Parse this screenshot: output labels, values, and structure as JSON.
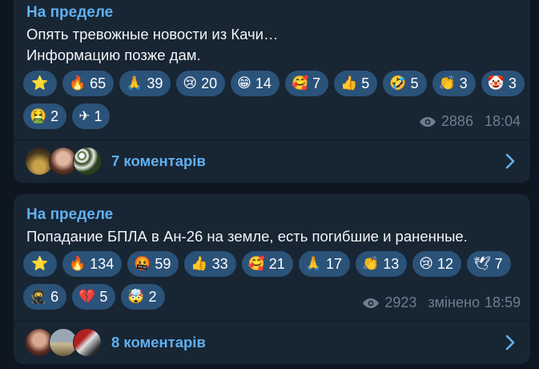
{
  "messages": [
    {
      "author": "На пределе",
      "lines": [
        "Опять тревожные новости из Качи…",
        "Информацию позже дам."
      ],
      "reactions": [
        {
          "icon": "star-icon",
          "glyph": "⭐",
          "count": ""
        },
        {
          "icon": "fire-icon",
          "glyph": "🔥",
          "count": "65"
        },
        {
          "icon": "pray-icon",
          "glyph": "🙏",
          "count": "39"
        },
        {
          "icon": "crying-face-icon",
          "glyph": "😢",
          "count": "20"
        },
        {
          "icon": "grin-icon",
          "glyph": "😁",
          "count": "14"
        },
        {
          "icon": "smiling-hearts-icon",
          "glyph": "🥰",
          "count": "7"
        },
        {
          "icon": "thumbs-up-icon",
          "glyph": "👍",
          "count": "5"
        },
        {
          "icon": "rofl-icon",
          "glyph": "🤣",
          "count": "5"
        },
        {
          "icon": "clap-icon",
          "glyph": "👏",
          "count": "3"
        },
        {
          "icon": "clown-icon",
          "glyph": "🤡",
          "count": "3"
        },
        {
          "icon": "vomit-face-icon",
          "glyph": "🤮",
          "count": "2"
        },
        {
          "icon": "airplane-icon",
          "glyph": "✈",
          "count": "1"
        }
      ],
      "views": "2886",
      "edited": "",
      "time": "18:04",
      "comments": "7 коментарів"
    },
    {
      "author": "На пределе",
      "lines": [
        "Попадание БПЛА в Ан-26 на земле, есть погибшие и раненные."
      ],
      "reactions": [
        {
          "icon": "star-icon",
          "glyph": "⭐",
          "count": ""
        },
        {
          "icon": "fire-icon",
          "glyph": "🔥",
          "count": "134"
        },
        {
          "icon": "cursing-face-icon",
          "glyph": "🤬",
          "count": "59"
        },
        {
          "icon": "thumbs-up-icon",
          "glyph": "👍",
          "count": "33"
        },
        {
          "icon": "smiling-hearts-icon",
          "glyph": "🥰",
          "count": "21"
        },
        {
          "icon": "pray-icon",
          "glyph": "🙏",
          "count": "17"
        },
        {
          "icon": "clap-icon",
          "glyph": "👏",
          "count": "13"
        },
        {
          "icon": "crying-face-icon",
          "glyph": "😢",
          "count": "12"
        },
        {
          "icon": "dove-icon",
          "glyph": "🕊",
          "count": "7"
        },
        {
          "icon": "ninja-icon",
          "glyph": "🥷",
          "count": "6"
        },
        {
          "icon": "broken-heart-icon",
          "glyph": "💔",
          "count": "5"
        },
        {
          "icon": "exploding-head-icon",
          "glyph": "🤯",
          "count": "2"
        }
      ],
      "views": "2923",
      "edited": "змінено",
      "time": "18:59",
      "comments": "8 коментарів"
    }
  ],
  "colors": {
    "background": "#0e1621",
    "bubble": "#182533",
    "accent": "#5fb0f0",
    "reaction_chip": "#2b5278",
    "meta_text": "#6d7f8f"
  }
}
